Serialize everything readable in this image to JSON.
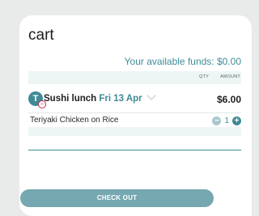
{
  "cart": {
    "title": "cart",
    "available_funds": "Your available funds: $0.00",
    "columns": {
      "qty": "QTY",
      "amount": "AMOUNT"
    },
    "order": {
      "avatar_initial": "T",
      "remove_symbol": "−",
      "meal": "Sushi lunch",
      "date": "Fri 13 Apr",
      "total": "$6.00",
      "items": [
        {
          "name": "Teriyaki Chicken on Rice",
          "quantity": "1",
          "minus": "−",
          "plus": "+"
        }
      ]
    },
    "checkout_label": "CHECK OUT"
  },
  "colors": {
    "accent": "#3f8a96",
    "checkout": "#76a8b1",
    "remove": "#c12a4b",
    "background": "#e9eaea"
  },
  "icons": [
    "chevron-down-icon",
    "minus-icon",
    "plus-icon",
    "remove-icon"
  ]
}
